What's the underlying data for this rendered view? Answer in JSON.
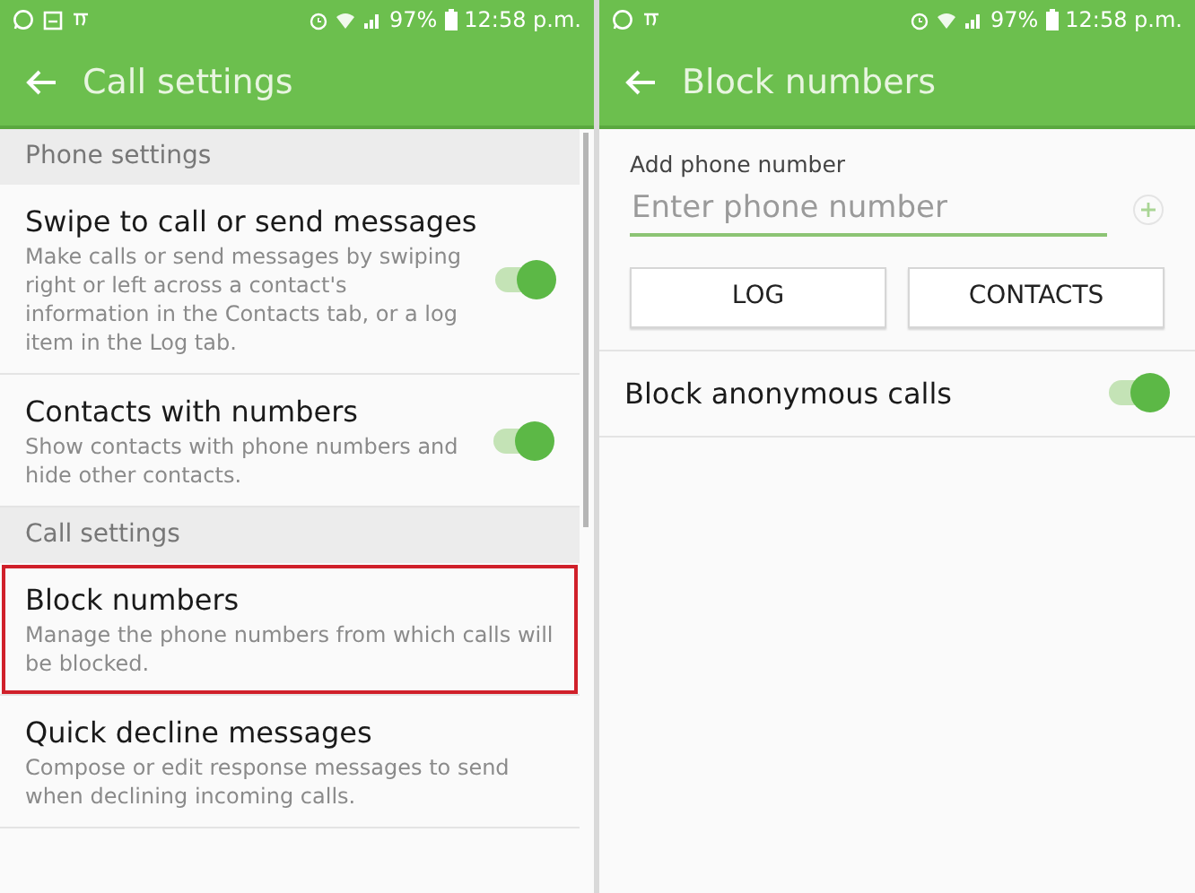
{
  "screens": [
    {
      "status_bar": {
        "notifications": [
          {
            "kind": "chat"
          },
          {
            "kind": "gallery"
          },
          {
            "kind": "flag"
          }
        ],
        "battery_text": "97%",
        "time": "12:58 p.m."
      },
      "title": "Call settings",
      "sections": [
        {
          "header": "Phone settings",
          "items": [
            {
              "kind": "toggle",
              "title": "Swipe to call or send messages",
              "subtitle": "Make calls or send messages by swiping right or left across a contact's information in the Contacts tab, or a log item in the Log tab.",
              "on": true,
              "highlighted": false
            },
            {
              "kind": "toggle",
              "title": "Contacts with numbers",
              "subtitle": "Show contacts with phone numbers and hide other contacts.",
              "on": true,
              "highlighted": false
            }
          ]
        },
        {
          "header": "Call settings",
          "items": [
            {
              "kind": "link",
              "title": "Block numbers",
              "subtitle": "Manage the phone numbers from which calls will be blocked.",
              "highlighted": true
            },
            {
              "kind": "link",
              "title": "Quick decline messages",
              "subtitle": "Compose or edit response messages to send when declining incoming calls.",
              "highlighted": false
            }
          ]
        }
      ]
    },
    {
      "status_bar": {
        "notifications": [
          {
            "kind": "chat"
          },
          {
            "kind": "flag"
          }
        ],
        "battery_text": "97%",
        "time": "12:58 p.m."
      },
      "title": "Block numbers",
      "add_number": {
        "label": "Add phone number",
        "placeholder": "Enter phone number"
      },
      "buttons": [
        "LOG",
        "CONTACTS"
      ],
      "sections": [
        {
          "items": [
            {
              "kind": "toggle",
              "title": "Block anonymous calls",
              "on": true,
              "highlighted": false
            }
          ]
        }
      ]
    }
  ]
}
